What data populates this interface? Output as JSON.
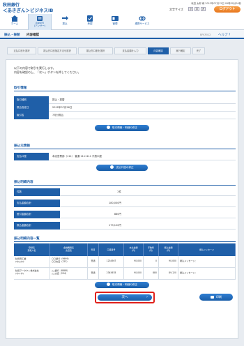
{
  "header": {
    "bank_name": "秋田銀行",
    "service_name": "＜あきぎん＞ビジネスIB",
    "user_line": "秋田 太郎 様 2012年07月12日 09時30分00秒",
    "text_size_label": "文字サイズ",
    "text_size_options": [
      "小",
      "中",
      "大"
    ],
    "logout_label": "ログアウト",
    "nav": [
      {
        "label": "ホーム",
        "icon": "home-icon"
      },
      {
        "label": "ANSER\n(アンサー)",
        "icon": "anser-icon"
      },
      {
        "label": "振込",
        "icon": "transfer-icon"
      },
      {
        "label": "承認",
        "icon": "approve-icon"
      },
      {
        "label": "管理",
        "icon": "manage-icon"
      },
      {
        "label": "連携サービス",
        "icon": "link-icon"
      }
    ]
  },
  "subheader": {
    "category": "振込・振替",
    "title": "内容確認",
    "screen_id": "BFKF012",
    "help_label": "ヘルプ"
  },
  "steps": [
    "支払口座を選択",
    "振込先口座指定方法を選択",
    "振込先口座を選択",
    "支払金額を入力",
    "内容確認",
    "実行確定",
    "完了"
  ],
  "active_step": 4,
  "intro": {
    "line1": "以下の内容で取引を実行します。",
    "line2": "内容を確認の上、「次へ」ボタンを押してください。"
  },
  "transaction": {
    "title": "取引情報",
    "rows": [
      {
        "label": "取引種別",
        "value": "振込・振替"
      },
      {
        "label": "振込指定日",
        "value": "2012年07月26日"
      },
      {
        "label": "取引名",
        "value": "7月分振込"
      }
    ],
    "edit_label": "取引情報・明細の修正"
  },
  "source": {
    "title": "振込元情報",
    "rows": [
      {
        "label": "支払口座",
        "value": "本店営業部（111） 普通 1111111 代表口座"
      }
    ],
    "edit_label": "支払口座の修正"
  },
  "summary": {
    "title": "振込明細内容",
    "rows": [
      {
        "label": "件数",
        "value": "2件"
      },
      {
        "label": "支払金額合計",
        "value": "180,000円"
      },
      {
        "label": "差引金額合計",
        "value": "880円"
      },
      {
        "label": "振込金額合計",
        "value": "179,120円"
      }
    ]
  },
  "detail": {
    "title": "振込明細内容一覧",
    "columns": [
      "登録名\n受取人名",
      "金融機関名\n支店名",
      "科目",
      "口座番号",
      "支払金額\n(円)",
      "手数料\n(円)",
      "振込金額\n(円)",
      "振込メッセージ"
    ],
    "rows": [
      {
        "name": "秋田商工業\nｱｷﾀｼｮｳｺｳ",
        "bank": "〇〇銀行（9999）\n〇〇支店（123）",
        "type": "普通",
        "account": "1234567",
        "pay": "90,000",
        "fee": "0",
        "amount": "90,000",
        "msg": "振込メッセージ："
      },
      {
        "name": "秋田アーネクト株式会社\nｱｷﾀｱｰﾈｸﾄ",
        "bank": "△△銀行（8888）\n△△支店（234）",
        "type": "普通",
        "account": "2345678",
        "pay": "90,000",
        "fee": "880",
        "amount": "89,120",
        "msg": "振込メッセージ："
      }
    ],
    "edit_label": "取引情報・明細の修正"
  },
  "actions": {
    "next_label": "次へ",
    "print_label": "印刷"
  }
}
